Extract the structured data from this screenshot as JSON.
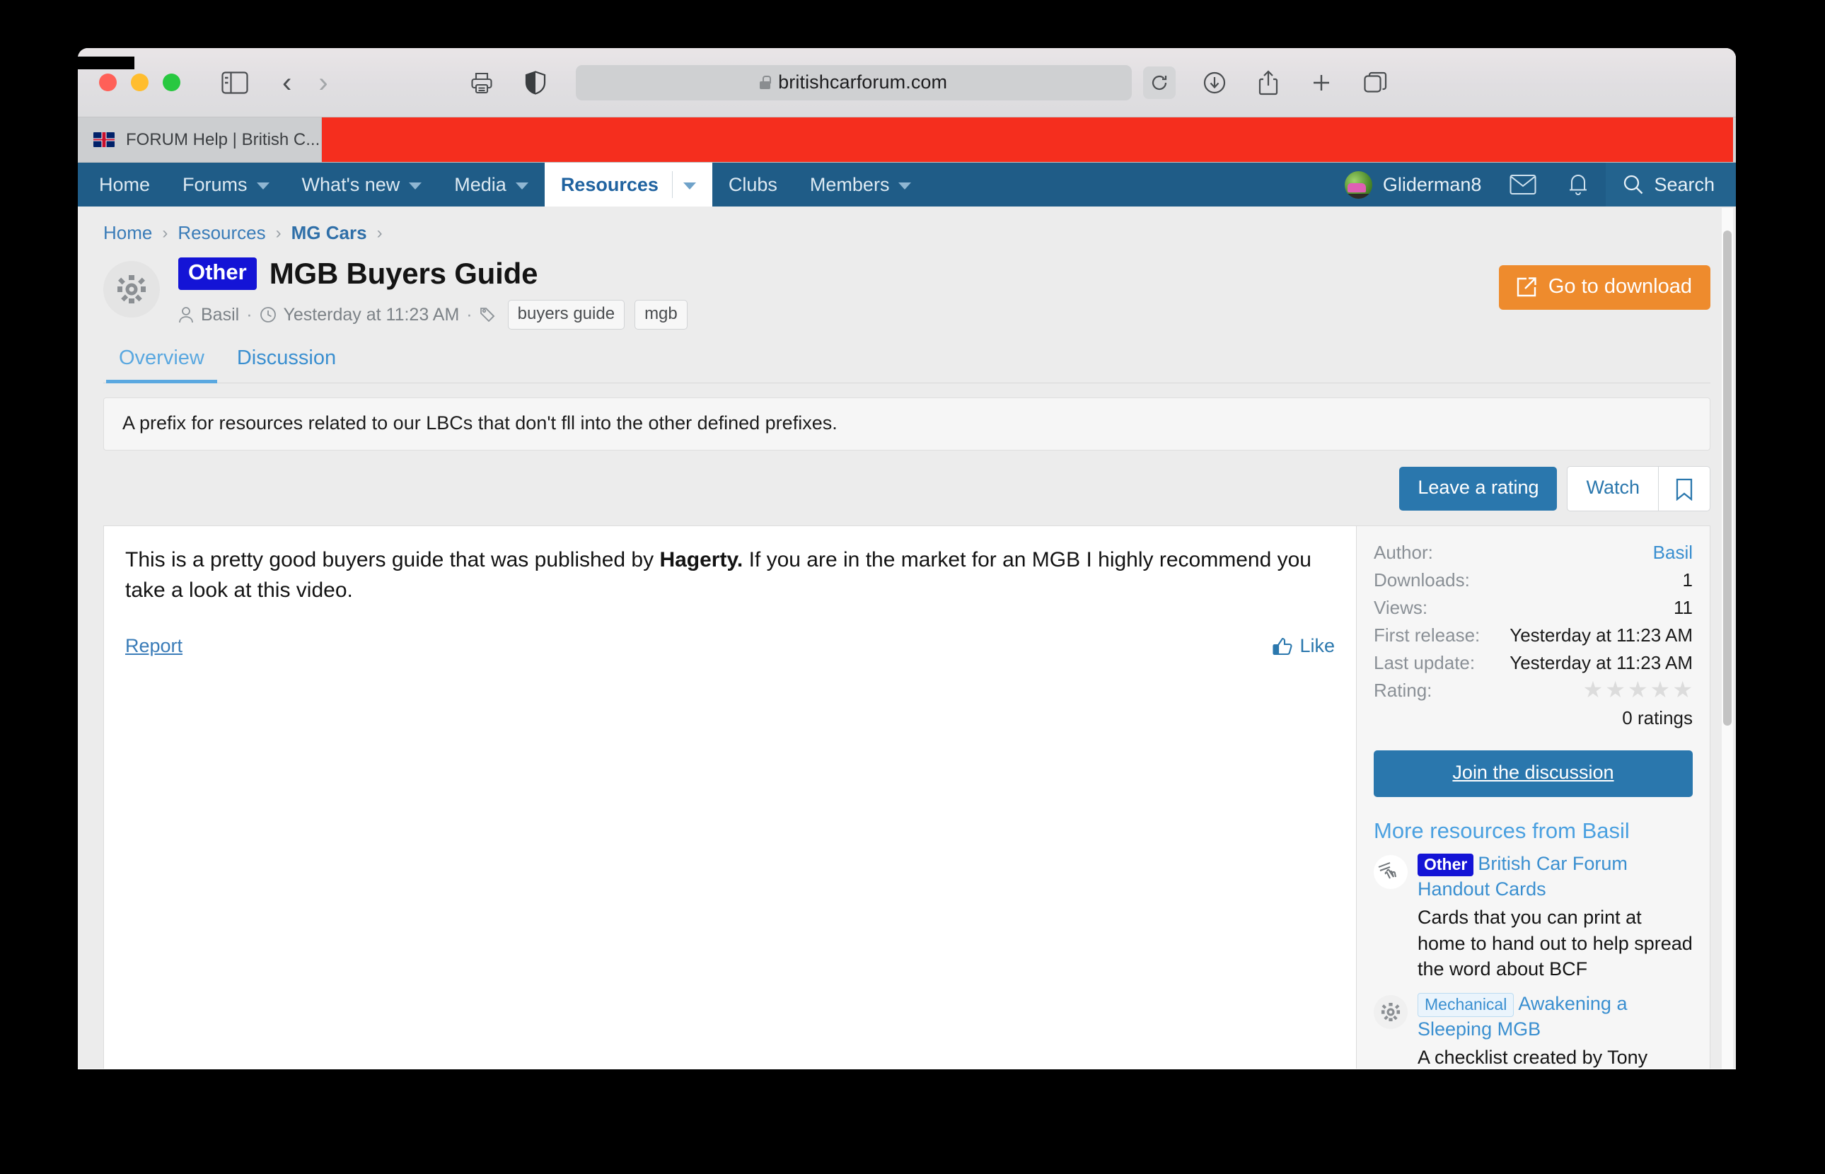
{
  "browser": {
    "url": "britishcarforum.com",
    "tab_title": "FORUM Help | British C...",
    "icons": {
      "sidebar": "sidebar-icon",
      "back": "back-arrow-icon",
      "forward": "forward-arrow-icon",
      "print": "print-icon",
      "shield": "privacy-shield-icon",
      "reload": "reload-icon",
      "downloads": "downloads-icon",
      "share": "share-icon",
      "newtab": "new-tab-icon",
      "tabs": "tab-overview-icon"
    }
  },
  "forum_nav": {
    "items": [
      {
        "label": "Home",
        "has_caret": false,
        "active": false
      },
      {
        "label": "Forums",
        "has_caret": true,
        "active": false
      },
      {
        "label": "What's new",
        "has_caret": true,
        "active": false
      },
      {
        "label": "Media",
        "has_caret": true,
        "active": false
      },
      {
        "label": "Resources",
        "has_caret": true,
        "active": true
      },
      {
        "label": "Clubs",
        "has_caret": false,
        "active": false
      },
      {
        "label": "Members",
        "has_caret": true,
        "active": false
      }
    ],
    "username": "Gliderman8",
    "search_label": "Search"
  },
  "breadcrumb": [
    {
      "label": "Home",
      "bold": false
    },
    {
      "label": "Resources",
      "bold": false
    },
    {
      "label": "MG Cars",
      "bold": true
    }
  ],
  "resource": {
    "prefix": "Other",
    "title": "MGB Buyers Guide",
    "author": "Basil",
    "date": "Yesterday at 11:23 AM",
    "tags": [
      "buyers guide",
      "mgb"
    ],
    "download_label": "Go to download",
    "description": "A prefix for resources related to our LBCs that don't fll into the other defined prefixes.",
    "body_part1": "This is a pretty good buyers guide that was published by ",
    "body_bold": "Hagerty.",
    "body_part2": " If you are in the market for an MGB I highly recommend you take a look at this video.",
    "report_label": "Report",
    "like_label": "Like"
  },
  "tabs": [
    {
      "label": "Overview",
      "active": true
    },
    {
      "label": "Discussion",
      "active": false
    }
  ],
  "actions": {
    "rate_label": "Leave a rating",
    "watch_label": "Watch",
    "bookmark_icon": "bookmark-icon"
  },
  "stats": {
    "rows": [
      {
        "key": "Author:",
        "value": "Basil",
        "is_link": true
      },
      {
        "key": "Downloads:",
        "value": "1",
        "is_link": false
      },
      {
        "key": "Views:",
        "value": "11",
        "is_link": false
      },
      {
        "key": "First release:",
        "value": "Yesterday at 11:23 AM",
        "is_link": false
      },
      {
        "key": "Last update:",
        "value": "Yesterday at 11:23 AM",
        "is_link": false
      }
    ],
    "rating_key": "Rating:",
    "rating_stars": 5,
    "rating_filled": 0,
    "ratings_count": "0 ratings"
  },
  "sidebar": {
    "join_label": "Join the discussion",
    "more_title": "More resources from Basil",
    "more_items": [
      {
        "badge": "Other",
        "badge_style": "solid",
        "title": "British Car Forum Handout Cards",
        "desc": "Cards that you can print at home to hand out to help spread the word about BCF",
        "icon": "handout-cards-icon"
      },
      {
        "badge": "Mechanical",
        "badge_style": "outline",
        "title": "Awakening a Sleeping MGB",
        "desc": "A checklist created by Tony",
        "icon": "gear-icon"
      }
    ]
  },
  "colors": {
    "nav_blue": "#1f5c87",
    "link_blue": "#3a8fd0",
    "badge_blue": "#1414d6",
    "orange": "#ee8b2d",
    "button_blue": "#2a77ad",
    "tab_red": "#f52e1e"
  }
}
